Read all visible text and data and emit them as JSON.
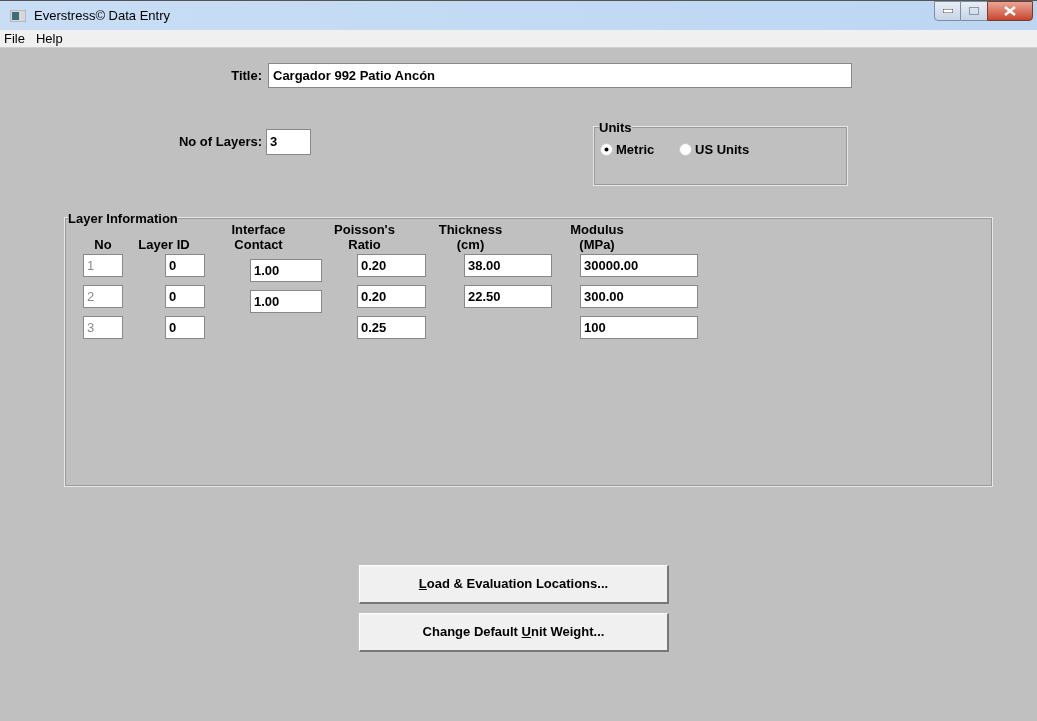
{
  "window": {
    "title": "Everstress© Data Entry"
  },
  "menu": [
    "File",
    "Help"
  ],
  "title_field": {
    "label": "Title:",
    "value": "Cargador 992 Patio Ancón"
  },
  "layers_field": {
    "label": "No of Layers:",
    "value": "3"
  },
  "units": {
    "legend": "Units",
    "options": [
      {
        "label": "Metric",
        "selected": true
      },
      {
        "label": "US Units",
        "selected": false
      }
    ]
  },
  "layer_information": {
    "legend": "Layer Information",
    "columns": [
      [
        "No"
      ],
      [
        "Layer ID"
      ],
      [
        "Interface",
        "Contact"
      ],
      [
        "Poisson's",
        "Ratio"
      ],
      [
        "Thickness",
        "(cm)"
      ],
      [
        "Modulus",
        "(MPa)"
      ]
    ],
    "rows": [
      {
        "no": "1",
        "layer_id": "0",
        "interface_contact": "1.00",
        "poissons_ratio": "0.20",
        "thickness": "38.00",
        "modulus": "30000.00"
      },
      {
        "no": "2",
        "layer_id": "0",
        "interface_contact": "1.00",
        "poissons_ratio": "0.20",
        "thickness": "22.50",
        "modulus": "300.00"
      },
      {
        "no": "3",
        "layer_id": "0",
        "poissons_ratio": "0.25",
        "modulus": "100"
      }
    ]
  },
  "buttons": [
    {
      "key": "L",
      "after": "oad & Evaluation Locations..."
    },
    {
      "before": "Change Default ",
      "key": "U",
      "after": "nit Weight..."
    }
  ]
}
